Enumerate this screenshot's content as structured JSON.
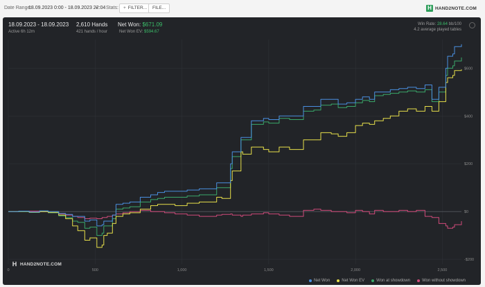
{
  "toolbar": {
    "date_range_label": "Date Range:",
    "date_range_value": "18.09.2023 0:00 - 18.09.2023 22:04",
    "stats_label": "Stats:",
    "filter_button": "FILTER...",
    "file_button": "FILE...",
    "logo_text": "HAND2NOTE.COM"
  },
  "summary": {
    "date": "18.09.2023 - 18.09.2023",
    "active": "Active 6h 12m",
    "hands": "2,610 Hands",
    "hands_per_hour": "421 hands / hour",
    "net_won_label": "Net Won:",
    "net_won_value": "$671.09",
    "net_won_ev_label": "Net Won  EV:",
    "net_won_ev_value": "$594.67",
    "win_rate_label": "Win Rate:",
    "win_rate_value": "28.64",
    "win_rate_unit": "bb/100",
    "avg_tables": "4.2 average played tables"
  },
  "watermark": "HAND2NOTE.COM",
  "colors": {
    "net_won": "#4a8fe0",
    "net_won_ev": "#e8e04a",
    "won_showdown": "#3aa86a",
    "won_without_showdown": "#d04a7a",
    "panel_bg": "#222428",
    "accent_green": "#3bbf6a"
  },
  "chart_data": {
    "type": "line",
    "xlim": [
      0,
      2610
    ],
    "ylim": [
      -220,
      720
    ],
    "x_ticks": [
      0,
      500,
      1000,
      1500,
      2000,
      2500
    ],
    "x_tick_labels": [
      "0",
      "500",
      "1,000",
      "1,500",
      "2,000",
      "2,500"
    ],
    "y_ticks": [
      -200,
      0,
      200,
      400,
      600
    ],
    "y_tick_labels": [
      "-$200",
      "$0",
      "$200",
      "$400",
      "$600"
    ],
    "legend_position": "bottom-right",
    "grid": true,
    "series": [
      {
        "name": "Net Won",
        "color_key": "net_won",
        "x": [
          0,
          60,
          120,
          180,
          230,
          290,
          330,
          370,
          400,
          440,
          470,
          510,
          540,
          550,
          570,
          600,
          620,
          660,
          700,
          760,
          820,
          860,
          900,
          960,
          1030,
          1100,
          1200,
          1230,
          1280,
          1290,
          1340,
          1350,
          1400,
          1470,
          1500,
          1560,
          1620,
          1700,
          1760,
          1800,
          1860,
          1900,
          1950,
          2000,
          2040,
          2080,
          2110,
          2160,
          2200,
          2250,
          2300,
          2350,
          2400,
          2440,
          2480,
          2520,
          2530,
          2560,
          2570,
          2610
        ],
        "y": [
          0,
          2,
          -2,
          3,
          0,
          -8,
          -12,
          -20,
          -20,
          -40,
          -35,
          -60,
          -55,
          -40,
          -40,
          -15,
          30,
          35,
          40,
          60,
          70,
          80,
          85,
          85,
          90,
          95,
          120,
          120,
          200,
          250,
          310,
          310,
          380,
          390,
          385,
          400,
          400,
          440,
          440,
          470,
          470,
          450,
          455,
          470,
          480,
          470,
          500,
          500,
          510,
          515,
          520,
          515,
          530,
          470,
          520,
          600,
          650,
          660,
          690,
          700
        ]
      },
      {
        "name": "Net Won  EV",
        "color_key": "net_won_ev",
        "x": [
          0,
          60,
          120,
          180,
          230,
          290,
          330,
          370,
          400,
          440,
          470,
          510,
          540,
          550,
          570,
          600,
          620,
          660,
          700,
          760,
          820,
          860,
          900,
          960,
          1030,
          1100,
          1200,
          1230,
          1280,
          1290,
          1340,
          1350,
          1400,
          1470,
          1500,
          1560,
          1620,
          1700,
          1760,
          1800,
          1860,
          1900,
          1950,
          2000,
          2040,
          2080,
          2110,
          2160,
          2200,
          2250,
          2300,
          2350,
          2400,
          2440,
          2480,
          2520,
          2530,
          2560,
          2570,
          2610
        ],
        "y": [
          0,
          1,
          -3,
          0,
          -3,
          -15,
          -30,
          -60,
          -80,
          -120,
          -110,
          -150,
          -140,
          -100,
          -90,
          -50,
          -20,
          -10,
          -5,
          10,
          25,
          30,
          30,
          25,
          35,
          40,
          60,
          55,
          130,
          170,
          250,
          240,
          270,
          260,
          250,
          270,
          260,
          300,
          300,
          330,
          325,
          315,
          330,
          360,
          370,
          365,
          380,
          390,
          400,
          420,
          430,
          420,
          440,
          420,
          460,
          540,
          560,
          570,
          590,
          595
        ]
      },
      {
        "name": "Won at showdown",
        "color_key": "won_showdown",
        "x": [
          0,
          60,
          120,
          180,
          230,
          290,
          330,
          370,
          400,
          440,
          470,
          510,
          540,
          550,
          570,
          600,
          620,
          660,
          700,
          760,
          820,
          860,
          900,
          960,
          1030,
          1100,
          1200,
          1230,
          1280,
          1290,
          1340,
          1350,
          1400,
          1470,
          1500,
          1560,
          1620,
          1700,
          1760,
          1800,
          1860,
          1900,
          1950,
          2000,
          2040,
          2080,
          2110,
          2160,
          2200,
          2250,
          2300,
          2350,
          2400,
          2440,
          2480,
          2520,
          2530,
          2560,
          2570,
          2610
        ],
        "y": [
          0,
          0,
          -4,
          2,
          -5,
          -18,
          -25,
          -40,
          -45,
          -70,
          -65,
          -100,
          -90,
          -60,
          -60,
          -30,
          10,
          15,
          20,
          40,
          50,
          55,
          60,
          60,
          65,
          70,
          100,
          100,
          180,
          230,
          300,
          300,
          365,
          375,
          370,
          390,
          385,
          420,
          425,
          445,
          450,
          435,
          440,
          455,
          465,
          460,
          485,
          490,
          495,
          500,
          505,
          500,
          510,
          460,
          500,
          570,
          600,
          610,
          630,
          645
        ]
      },
      {
        "name": "Won without showdown",
        "color_key": "won_without_showdown",
        "x": [
          0,
          60,
          120,
          180,
          230,
          290,
          330,
          370,
          400,
          440,
          470,
          510,
          540,
          550,
          570,
          600,
          620,
          660,
          700,
          760,
          820,
          860,
          900,
          960,
          1030,
          1100,
          1200,
          1230,
          1280,
          1290,
          1340,
          1350,
          1400,
          1470,
          1500,
          1560,
          1620,
          1700,
          1760,
          1800,
          1860,
          1900,
          1950,
          2000,
          2040,
          2080,
          2110,
          2160,
          2200,
          2250,
          2300,
          2350,
          2400,
          2440,
          2480,
          2520,
          2530,
          2560,
          2570,
          2610
        ],
        "y": [
          0,
          0,
          2,
          0,
          -5,
          -10,
          -15,
          -20,
          -25,
          -30,
          -28,
          -30,
          -25,
          -25,
          -20,
          -15,
          -10,
          -5,
          0,
          5,
          0,
          0,
          -5,
          -10,
          -15,
          -20,
          -15,
          -12,
          -10,
          -15,
          -20,
          -15,
          -10,
          -5,
          -10,
          -15,
          -20,
          5,
          10,
          5,
          0,
          0,
          -5,
          5,
          0,
          -10,
          5,
          0,
          0,
          5,
          0,
          5,
          -20,
          -25,
          -50,
          -60,
          -70,
          -65,
          -55,
          -40
        ]
      }
    ]
  }
}
